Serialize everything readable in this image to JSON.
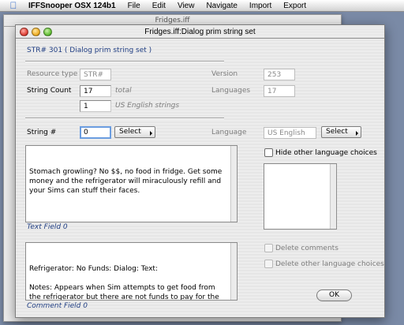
{
  "menubar": {
    "app_name": "IFFSnooper OSX 124b1",
    "items": [
      "File",
      "Edit",
      "View",
      "Navigate",
      "Import",
      "Export"
    ]
  },
  "background_window": {
    "title": "Fridges.iff"
  },
  "window": {
    "title": "Fridges.iff:Dialog prim string set",
    "heading": "STR# 301 ( Dialog prim string set )",
    "resource_type": {
      "label": "Resource type",
      "value": "STR#"
    },
    "version": {
      "label": "Version",
      "value": "253"
    },
    "string_count": {
      "label": "String Count",
      "value": "17",
      "suffix": "total"
    },
    "languages": {
      "label": "Languages",
      "value": "17"
    },
    "english_strings": {
      "value": "1",
      "suffix": "US English strings"
    },
    "string_number": {
      "label": "String #",
      "value": "0",
      "select_label": "Select"
    },
    "language": {
      "label": "Language",
      "value": "US English",
      "select_label": "Select"
    },
    "text_field": {
      "content": "Stomach growling? No $$, no food in fridge. Get some money and the refrigerator will miraculously refill and your Sims can stuff their faces.",
      "caption": "Text Field 0"
    },
    "hide_other_languages": {
      "label": "Hide other language choices",
      "checked": false
    },
    "comment_field": {
      "content": "Refrigerator: No Funds: Dialog: Text:\n\nNotes: Appears when Sim attempts to get food from the refrigerator but there are not funds to pay for the food.",
      "caption": "Comment Field 0"
    },
    "delete_comments": {
      "label": "Delete comments",
      "checked": false
    },
    "delete_other_languages": {
      "label": "Delete other language choices",
      "checked": false
    },
    "ok_label": "OK"
  },
  "colors": {
    "accent_blue": "#1f3d82",
    "focus_ring": "#6b9de0"
  }
}
